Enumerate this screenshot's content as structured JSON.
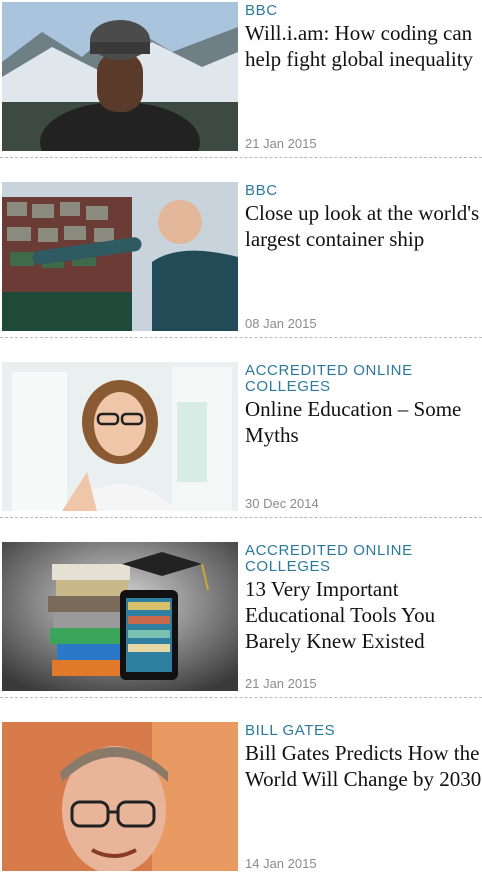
{
  "articles": [
    {
      "source": "BBC",
      "title": "Will.i.am: How coding can help fight global inequality",
      "date": "21 Jan 2015",
      "image": "man-in-beanie-mountains-photo"
    },
    {
      "source": "BBC",
      "title": "Close up look at the world's largest container ship",
      "date": "08 Jan 2015",
      "image": "man-by-container-ship-photo"
    },
    {
      "source": "ACCREDITED ONLINE COLLEGES",
      "title": "Online Education – Some Myths",
      "date": "30 Dec 2014",
      "image": "woman-with-glasses-photo"
    },
    {
      "source": "ACCREDITED ONLINE COLLEGES",
      "title": "13 Very Important Educational Tools You Barely Knew Existed",
      "date": "21 Jan 2015",
      "image": "books-and-tablet-photo"
    },
    {
      "source": "BILL GATES",
      "title": "Bill Gates Predicts How the World Will Change by 2030",
      "date": "14 Jan 2015",
      "image": "bill-gates-portrait-photo"
    }
  ],
  "colors": {
    "source": "#2b7a9d",
    "title": "#111111",
    "date": "#8c8c8c",
    "divider": "#b9b9b9"
  }
}
